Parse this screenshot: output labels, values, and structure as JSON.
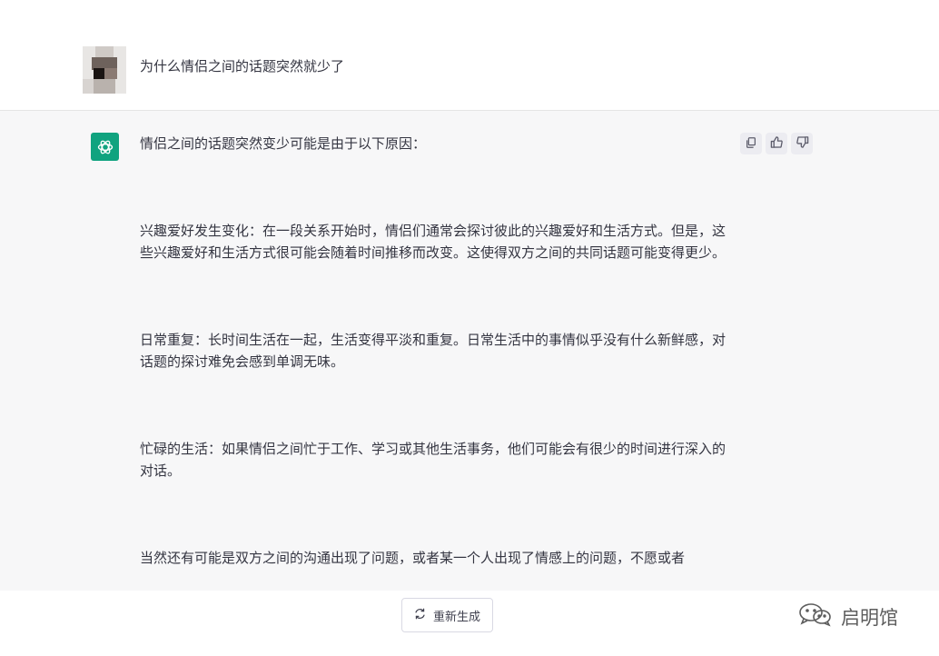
{
  "user_message": {
    "text": "为什么情侣之间的话题突然就少了"
  },
  "assistant_message": {
    "paragraphs": [
      "情侣之间的话题突然变少可能是由于以下原因：",
      "兴趣爱好发生变化：在一段关系开始时，情侣们通常会探讨彼此的兴趣爱好和生活方式。但是，这些兴趣爱好和生活方式很可能会随着时间推移而改变。这使得双方之间的共同话题可能变得更少。",
      "日常重复：长时间生活在一起，生活变得平淡和重复。日常生活中的事情似乎没有什么新鲜感，对话题的探讨难免会感到单调无味。",
      "忙碌的生活：如果情侣之间忙于工作、学习或其他生活事务，他们可能会有很少的时间进行深入的对话。",
      "当然还有可能是双方之间的沟通出现了问题，或者某一个人出现了情感上的问题，不愿或者"
    ],
    "actions": [
      "copy-icon",
      "thumbs-up-icon",
      "thumbs-down-icon"
    ]
  },
  "footer": {
    "regenerate_label": "重新生成"
  },
  "watermark": {
    "text": "启明馆"
  },
  "colors": {
    "brand": "#10a37f",
    "bot_bg": "#f7f7f8"
  }
}
